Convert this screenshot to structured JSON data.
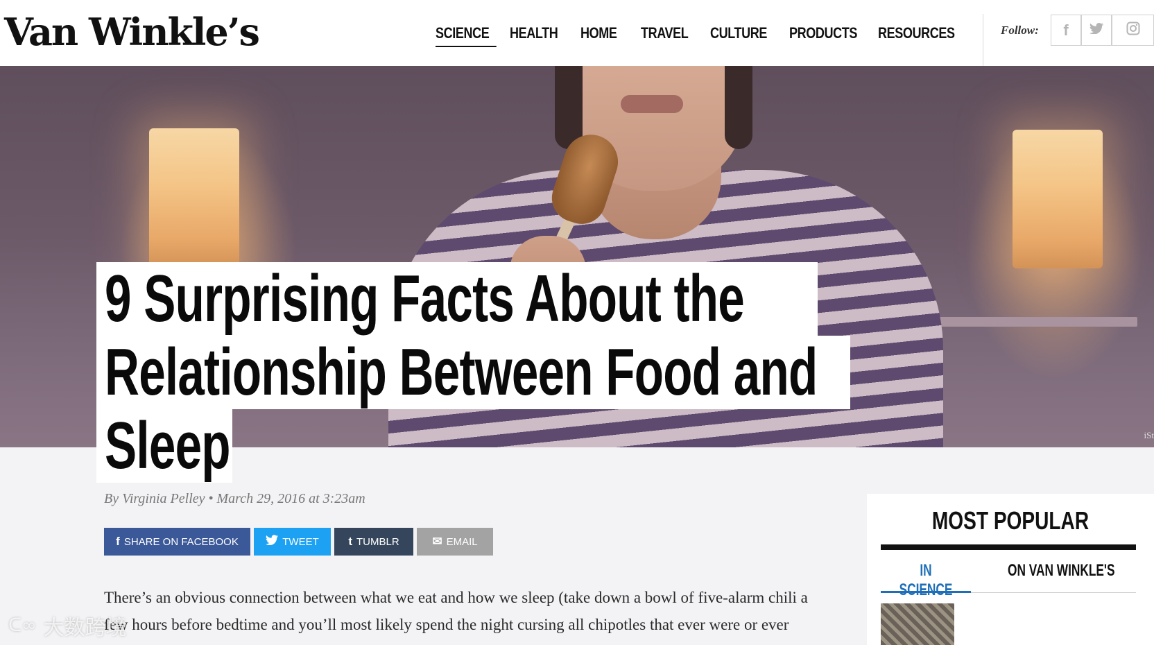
{
  "header": {
    "logo": "Van Winkle’s",
    "nav": [
      {
        "label": "SCIENCE",
        "active": true
      },
      {
        "label": "HEALTH"
      },
      {
        "label": "HOME"
      },
      {
        "label": "TRAVEL"
      },
      {
        "label": "CULTURE"
      },
      {
        "label": "PRODUCTS"
      },
      {
        "label": "RESOURCES"
      }
    ],
    "follow_label": "Follow:",
    "social": [
      {
        "icon": "facebook-icon",
        "glyph": "f"
      },
      {
        "icon": "twitter-icon",
        "glyph": "t"
      },
      {
        "icon": "instagram-icon",
        "glyph": "◻"
      }
    ]
  },
  "hero": {
    "photo_credit": "iSt"
  },
  "article": {
    "title_lines": [
      "9 Surprising Facts About the",
      "Relationship Between Food and",
      "Sleep"
    ],
    "byline": "By Virginia Pelley • March 29, 2016 at 3:23am",
    "share": [
      {
        "label": "SHARE ON FACEBOOK",
        "icon": "facebook-icon",
        "glyph": "f",
        "color": "#3b5998"
      },
      {
        "label": "TWEET",
        "icon": "twitter-icon",
        "glyph": "🐦",
        "color": "#1da1f2"
      },
      {
        "label": "TUMBLR",
        "icon": "tumblr-icon",
        "glyph": "t",
        "color": "#35465c"
      },
      {
        "label": "EMAIL",
        "icon": "email-icon",
        "glyph": "✉",
        "color": "#a3a3a3"
      }
    ],
    "body_lines": [
      "There’s an obvious connection between what we eat and how we sleep (take down a bowl of five-alarm chili a",
      "few hours before bedtime and you’ll most likely spend the night cursing all chipotles that ever were or ever"
    ]
  },
  "sidebar": {
    "title": "MOST POPULAR",
    "tabs": [
      {
        "label": "IN SCIENCE",
        "active": true,
        "color": "#1f6fb8"
      },
      {
        "label": "ON VAN WINKLE'S",
        "active": false,
        "color": "#111111"
      }
    ]
  },
  "watermark": "大数跨境"
}
